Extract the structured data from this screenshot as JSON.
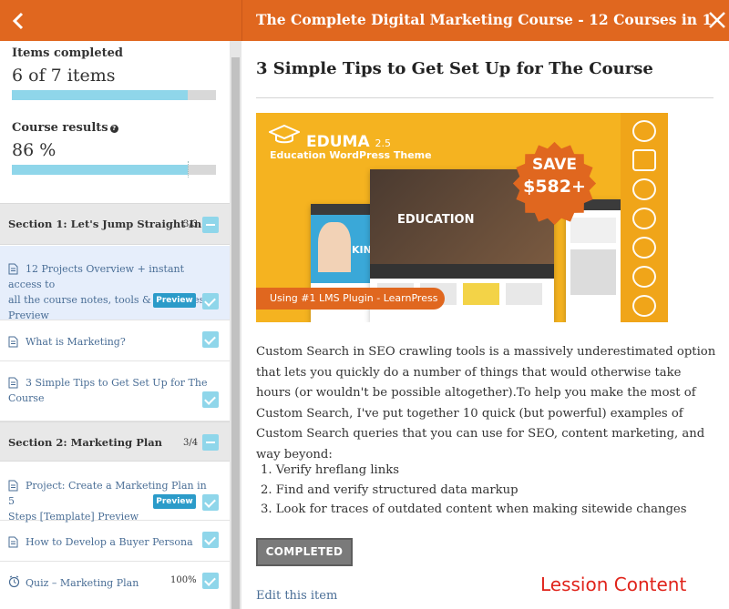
{
  "header": {
    "title": "The Complete Digital Marketing Course - 12 Courses in 1",
    "back_icon": "chevron-left-icon",
    "close_icon": "close-icon",
    "color": "#e0671f"
  },
  "sidebar": {
    "items_completed_label": "Items completed",
    "items_completed_value": "6 of 7 items",
    "items_progress": 0.86,
    "course_results_label": "Course results",
    "course_results_value": "86 %",
    "course_progress": 0.86,
    "sections": [
      {
        "title": "Section 1: Let's Jump Straight In!",
        "count": "3/3",
        "items": [
          {
            "line1": "12 Projects Overview + instant access to",
            "line2": "all the course notes, tools & templates",
            "line3": "Preview",
            "badge": "Preview",
            "active": true
          },
          {
            "line1": "What is Marketing?"
          },
          {
            "line1": "3 Simple Tips to Get Set Up for The",
            "line2": "Course"
          }
        ]
      },
      {
        "title": "Section 2: Marketing Plan",
        "count": "3/4",
        "items": [
          {
            "line1": "Project: Create a Marketing Plan in 5",
            "line2": "Steps [Template] Preview",
            "badge": "Preview"
          },
          {
            "line1": "How to Develop a Buyer Persona"
          },
          {
            "line1": "Quiz – Marketing Plan",
            "result": "100%",
            "icon": "clock-icon"
          }
        ]
      }
    ]
  },
  "content": {
    "heading": "3 Simple Tips to Get Set Up for The Course",
    "banner": {
      "brand": "EDUMA",
      "version": "2.5",
      "tagline": "Education WordPress Theme",
      "save_line1": "SAVE",
      "save_line2": "$582+",
      "ribbon": "Using #1 LMS Plugin - LearnPress",
      "mock_heading": "EDUCATION",
      "mock_kinder": "KINDE",
      "background": "#f5b320"
    },
    "paragraph": "Custom Search in SEO crawling tools is a massively underestimated option that lets you quickly do a number of things that would otherwise take hours (or wouldn't be possible altogether).To help you make the most of Custom Search, I've put together 10 quick (but powerful) examples of Custom Search queries that you can use for SEO, content marketing, and way beyond:",
    "list": [
      "1. Verify hreflang links",
      "2. Find and verify structured data markup",
      "3. Look for traces of outdated content when making sitewide changes"
    ],
    "completed_button": "COMPLETED",
    "edit_link": "Edit this item",
    "annotation": "Lession Content"
  }
}
